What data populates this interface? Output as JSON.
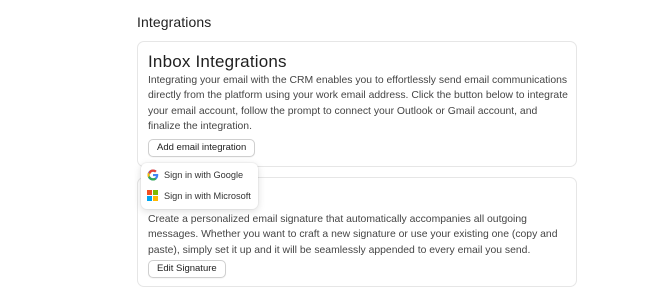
{
  "page": {
    "title": "Integrations"
  },
  "inbox_card": {
    "title": "Inbox Integrations",
    "description": "Integrating your email with the CRM enables you to effortlessly send email communications directly from the platform using your work email address. Click the button below to integrate your email account, follow the prompt to connect your Outlook or Gmail account, and finalize the integration.",
    "button_label": "Add email integration"
  },
  "dropdown": {
    "items": [
      {
        "label": "Sign in with Google",
        "icon": "google-icon"
      },
      {
        "label": "Sign in with Microsoft",
        "icon": "microsoft-icon"
      }
    ]
  },
  "signature_card": {
    "description": "Create a personalized email signature that automatically accompanies all outgoing messages. Whether you want to craft a new signature or use your existing one (copy and paste), simply set it up and it will be seamlessly appended to every email you send.",
    "button_label": "Edit Signature"
  },
  "colors": {
    "google_blue": "#4285F4",
    "google_red": "#EA4335",
    "google_yellow": "#FBBC05",
    "google_green": "#34A853",
    "ms_red": "#F25022",
    "ms_green": "#7FBA00",
    "ms_blue": "#00A4EF",
    "ms_yellow": "#FFB900"
  }
}
